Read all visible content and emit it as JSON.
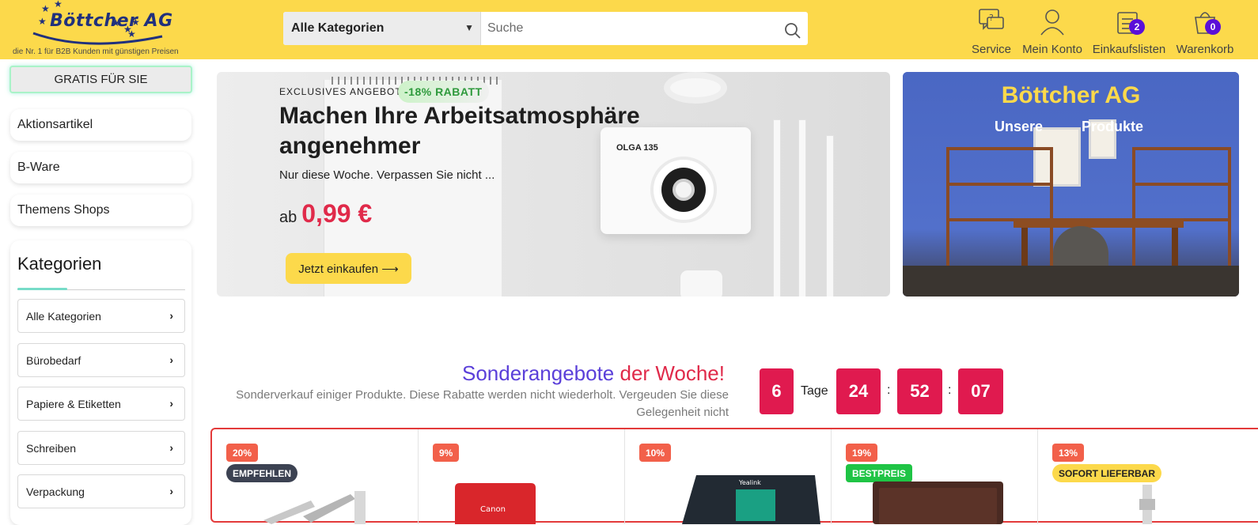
{
  "header": {
    "logo_title": "Böttcher AG",
    "logo_tagline": "die Nr. 1 für B2B Kunden mit günstigen Preisen",
    "search": {
      "category": "Alle Kategorien",
      "placeholder": "Suche"
    },
    "nav": [
      {
        "label": "Service",
        "icon": "service-chat-icon"
      },
      {
        "label": "Mein Konto",
        "icon": "user-icon"
      },
      {
        "label": "Einkaufslisten",
        "icon": "list-icon",
        "badge": "2"
      },
      {
        "label": "Warenkorb",
        "icon": "cart-icon",
        "badge": "0"
      }
    ],
    "colors": {
      "background": "#fcd94b",
      "badge": "#5a0fd8"
    }
  },
  "sidebar": {
    "gratis": "GRATIS FÜR SIE",
    "links": [
      "Aktionsartikel",
      "B-Ware",
      "Themens Shops"
    ],
    "categories_title": "Kategorien",
    "categories": [
      "Alle Kategorien",
      "Bürobedarf",
      "Papiere & Etiketten",
      "Schreiben",
      "Verpackung"
    ]
  },
  "hero": {
    "eyebrow": "EXCLUSIVES ANGEBOT",
    "badge": "-18% RABATT",
    "title": "Machen Ihre Arbeitsatmosphäre angenehmer",
    "subtitle": "Nur diese Woche. Verpassen Sie nicht ...",
    "price_prefix": "ab",
    "price": "0,99 €",
    "button": "Jetzt einkaufen ⟶",
    "camera_label": "OLGA 135",
    "colors": {
      "price": "#e02a4a",
      "badge_text": "#2e9a3c"
    }
  },
  "promo": {
    "title": "Böttcher AG",
    "sub_left": "Unsere",
    "sub_right": "Produkte"
  },
  "special": {
    "title_part1": "Sonderangebote",
    "title_part2": "der Woche!",
    "description": "Sonderverkauf einiger Produkte. Diese Rabatte werden nicht wiederholt. Vergeuden Sie diese Gelegenheit nicht",
    "countdown": {
      "days": "6",
      "days_label": "Tage",
      "hours": "24",
      "minutes": "52",
      "seconds": "07",
      "sep": ":"
    },
    "colors": {
      "title1": "#5a3fd9",
      "title2": "#e02a4a",
      "countdown": "#e01a4f"
    }
  },
  "products": [
    {
      "discount": "20%",
      "tag": "EMPFEHLEN"
    },
    {
      "discount": "9%",
      "brand": "Canon"
    },
    {
      "discount": "10%",
      "brand": "Yealink"
    },
    {
      "discount": "19%",
      "tag": "BESTPREIS"
    },
    {
      "discount": "13%",
      "tag": "SOFORT LIEFERBAR"
    }
  ]
}
